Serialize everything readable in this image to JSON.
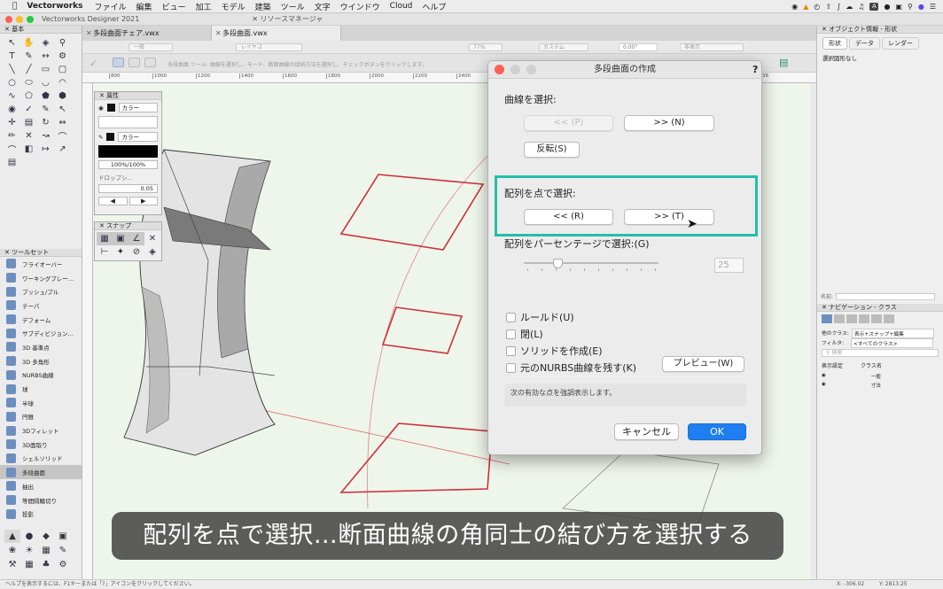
{
  "menubar": {
    "app": "Vectorworks",
    "items": [
      "ファイル",
      "編集",
      "ビュー",
      "加工",
      "モデル",
      "建築",
      "ツール",
      "文字",
      "ウインドウ",
      "Cloud",
      "ヘルプ"
    ],
    "user": "サインイン"
  },
  "window": {
    "title": "Vectorworks Designer 2021",
    "resource_manager": "リソースマネージャ",
    "tabs": [
      "多段曲面チェア.vwx",
      "多段曲面.vwx"
    ]
  },
  "toolbar": {
    "class_value": "一般",
    "layer_value": "レイヤ-2",
    "zoom": "77%",
    "render": "カステム",
    "view": "非表示",
    "angle": "0.00°",
    "hint": "多段曲面 ツール: 曲線を選択し、モード、断面曲線の接続方法を選択し、チェックボタンをクリックします。"
  },
  "ruler": [
    "800",
    "1000",
    "1200",
    "1400",
    "1600",
    "1800",
    "2000",
    "2200",
    "2400",
    "2600",
    "2800",
    "3000",
    "3200",
    "3400",
    "3600",
    "38"
  ],
  "palettes": {
    "basic": "基本",
    "toolsets": "ツールセット",
    "toolset_items": [
      "フライオーバー",
      "ワーキングプレー…",
      "プッシュ/プル",
      "テーパ",
      "デフォーム",
      "サブディビジョン…",
      "3D 基準点",
      "3D 多角形",
      "NURBS曲線",
      "球",
      "半球",
      "円錐",
      "3Dフィレット",
      "3D面取り",
      "シェルソリッド",
      "多段曲面",
      "抽出",
      "等間隔輪切り",
      "投影"
    ],
    "attributes": {
      "title": "属性",
      "fill_type": "カラー",
      "pen_type": "カラー",
      "opacity": "100%/100%",
      "shadow": "ドロップシ…",
      "line_weight": "0.05"
    },
    "snap": {
      "title": "スナップ"
    }
  },
  "dialog": {
    "title": "多段曲面の作成",
    "curve_label": "曲線を選択:",
    "prev_btn": "<< (P)",
    "next_btn": ">> (N)",
    "reverse_btn": "反転(S)",
    "point_label": "配列を点で選択:",
    "point_prev_btn": "<< (R)",
    "point_next_btn": ">> (T)",
    "percent_label": "配列をパーセンテージで選択:(G)",
    "percent_value": "25",
    "percent_level": 0.25,
    "checkboxes": [
      "ルールド(U)",
      "閉(L)",
      "ソリッドを作成(E)",
      "元のNURBS曲線を残す(K)"
    ],
    "preview_btn": "プレビュー(W)",
    "message": "次の有効な点を強調表示します。",
    "cancel_btn": "キャンセル",
    "ok_btn": "OK",
    "highlight_color": "#23bfa8",
    "ok_color": "#1f7ef0"
  },
  "object_info": {
    "title": "オブジェクト情報 - 形状",
    "tabs": [
      "形状",
      "データ",
      "レンダー"
    ],
    "status": "選択図形なし",
    "name_label": "名前:"
  },
  "navigation": {
    "title": "ナビゲーション - クラス",
    "other_class_label": "他のクラス:",
    "other_class_value": "表示+スナップ+編集",
    "filter_label": "フィルタ:",
    "filter_value": "<すべてのクラス>",
    "search_placeholder": "検索",
    "col_visibility": "表示設定",
    "col_class": "クラス名",
    "rows": [
      "一般",
      "寸法"
    ]
  },
  "status": {
    "hint": "ヘルプを表示するには、F1キーまたは「?」アイコンをクリックしてください。",
    "x": "X: -306.02",
    "y": "Y: 2813.25"
  },
  "caption": "配列を点で選択…断面曲線の角同士の結び方を選択する"
}
